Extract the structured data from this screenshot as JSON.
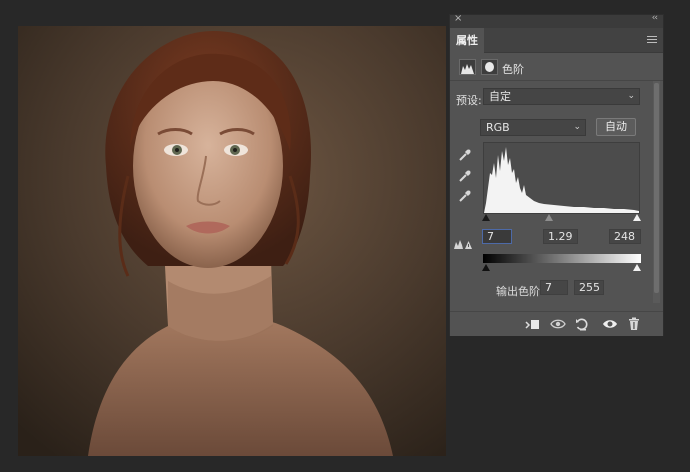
{
  "panel": {
    "close_glyph": "×",
    "collapse_glyph": "‹‹",
    "tab_label": "属性",
    "menu_icon": "panel-menu-icon",
    "header": {
      "layer_icon": "levels-adjustment-icon",
      "mask_icon": "layer-mask-icon",
      "title": "色阶"
    },
    "preset": {
      "label": "预设:",
      "value": "自定"
    },
    "channel": {
      "value": "RGB"
    },
    "auto_label": "自动",
    "eyedroppers": [
      "black-point-eyedropper-icon",
      "gray-point-eyedropper-icon",
      "white-point-eyedropper-icon"
    ],
    "input_levels": {
      "black": "7",
      "gamma": "1.29",
      "white": "248"
    },
    "output": {
      "label": "输出色阶:",
      "black": "7",
      "white": "255"
    },
    "footer_icons": [
      "clip-to-layer-icon",
      "view-previous-state-icon",
      "reset-icon",
      "visibility-icon",
      "delete-icon"
    ]
  },
  "colors": {
    "panel_bg": "#535353",
    "workspace_bg": "#282828",
    "active_field_border": "#4d6aa8"
  }
}
